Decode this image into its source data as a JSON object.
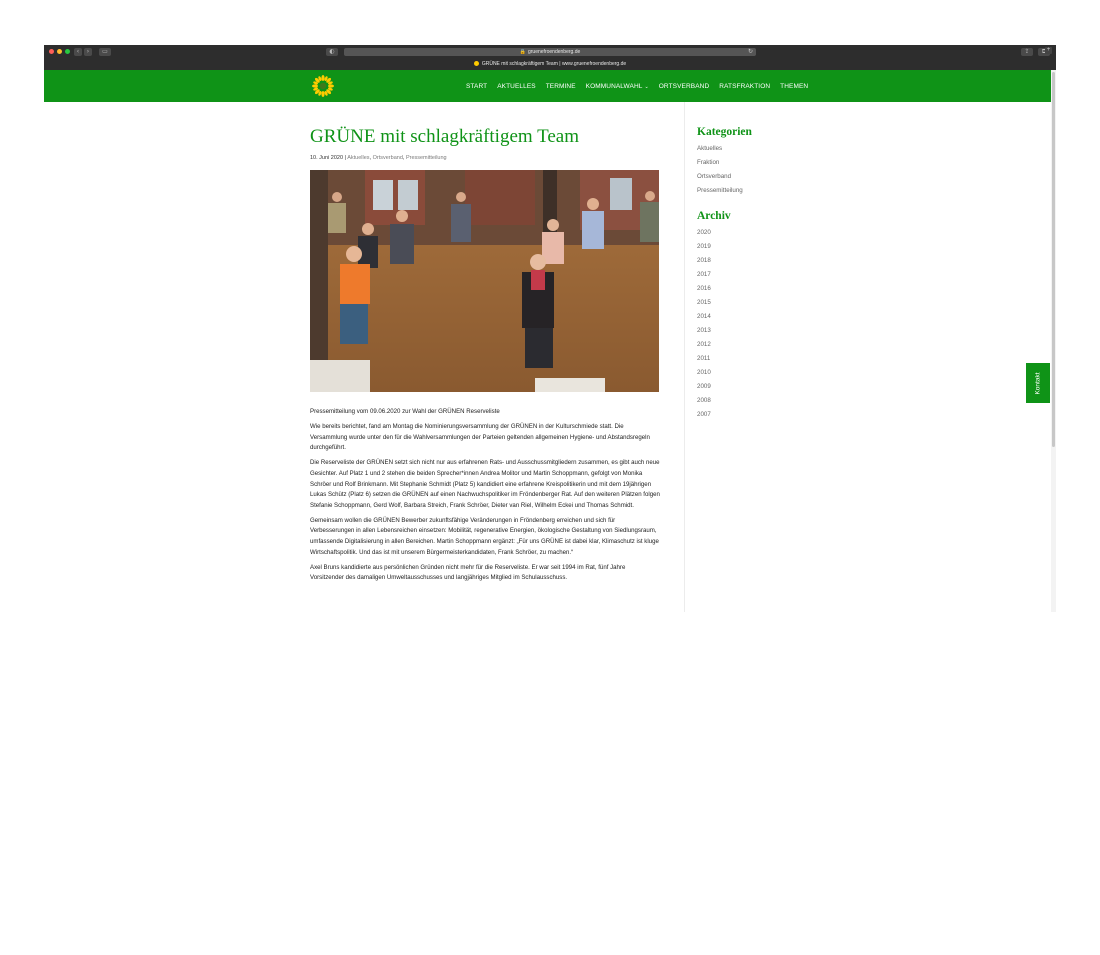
{
  "browser": {
    "url": "gruenefroendenberg.de",
    "tab_title": "GRÜNE mit schlagkräftigem Team | www.gruenefroendenberg.de",
    "new_tab_label": "+",
    "reader_label": "◐",
    "sidebar_label": "▭",
    "share_label": "⇪",
    "tabs_label": "⧉",
    "reload_icon": "↻",
    "lock_icon": "🔒"
  },
  "nav": {
    "items": [
      {
        "label": "START"
      },
      {
        "label": "AKTUELLES"
      },
      {
        "label": "TERMINE"
      },
      {
        "label": "KOMMUNALWAHL",
        "dropdown": "⌄"
      },
      {
        "label": "ORTSVERBAND"
      },
      {
        "label": "RATSFRAKTION"
      },
      {
        "label": "THEMEN"
      }
    ]
  },
  "post": {
    "title": "GRÜNE mit schlagkräftigem Team",
    "date": "10. Juni 2020",
    "separator": " | ",
    "categories": [
      "Aktuelles",
      "Ortsverband",
      "Pressemitteilung"
    ],
    "paragraphs": [
      "Pressemitteilung vom 09.06.2020 zur Wahl der GRÜNEN Reserveliste",
      "Wie bereits berichtet, fand am Montag die Nominierungsversammlung der GRÜNEN in der Kulturschmiede statt. Die Versammlung wurde unter den für die Wahlversammlungen der Parteien geltenden allgemeinen Hygiene- und Abstandsregeln durchgeführt.",
      "Die Reserveliste der GRÜNEN setzt sich nicht nur aus erfahrenen Rats- und Ausschussmitgliedern zusammen, es gibt auch neue Gesichter. Auf Platz 1 und 2 stehen die beiden Sprecher*innen Andrea Molitor und Martin Schoppmann, gefolgt von Monika Schröer und Rolf Brinkmann. Mit Stephanie Schmidt (Platz 5) kandidiert eine erfahrene Kreispolitikerin und mit dem 19jährigen Lukas Schütz (Platz 6) setzen die GRÜNEN auf einen Nachwuchspolitiker im Fröndenberger Rat. Auf den weiteren Plätzen folgen Stefanie Schoppmann, Gerd Wolf, Barbara Streich, Frank Schröer, Dieter van Riel, Wilhelm Eckei und Thomas Schmidt.",
      "Gemeinsam wollen die GRÜNEN Bewerber zukunftsfähige Veränderungen in Fröndenberg erreichen und sich für Verbesserungen in allen Lebensreichen einsetzen: Mobilität, regenerative Energien, ökologische Gestaltung von Siedlungsraum, umfassende Digitalisierung in allen Bereichen. Martin Schoppmann ergänzt: „Für uns GRÜNE ist dabei klar, Klimaschutz ist kluge Wirtschaftspolitik. Und das ist mit unserem Bürgermeisterkandidaten, Frank Schröer, zu machen.“",
      "Axel Bruns kandidierte aus persönlichen Gründen nicht mehr für die Reserveliste. Er war seit 1994 im Rat, fünf Jahre Vorsitzender des damaligen Umweltausschusses und langjähriges Mitglied im Schulausschuss."
    ]
  },
  "sidebar": {
    "categories_title": "Kategorien",
    "categories": [
      "Aktuelles",
      "Fraktion",
      "Ortsverband",
      "Pressemitteilung"
    ],
    "archive_title": "Archiv",
    "archive": [
      "2020",
      "2019",
      "2018",
      "2017",
      "2016",
      "2015",
      "2014",
      "2013",
      "2012",
      "2011",
      "2010",
      "2009",
      "2008",
      "2007"
    ]
  },
  "kontakt_label": "Kontakt",
  "colors": {
    "brand_green": "#0f9317",
    "sun_yellow": "#ffcc00"
  }
}
